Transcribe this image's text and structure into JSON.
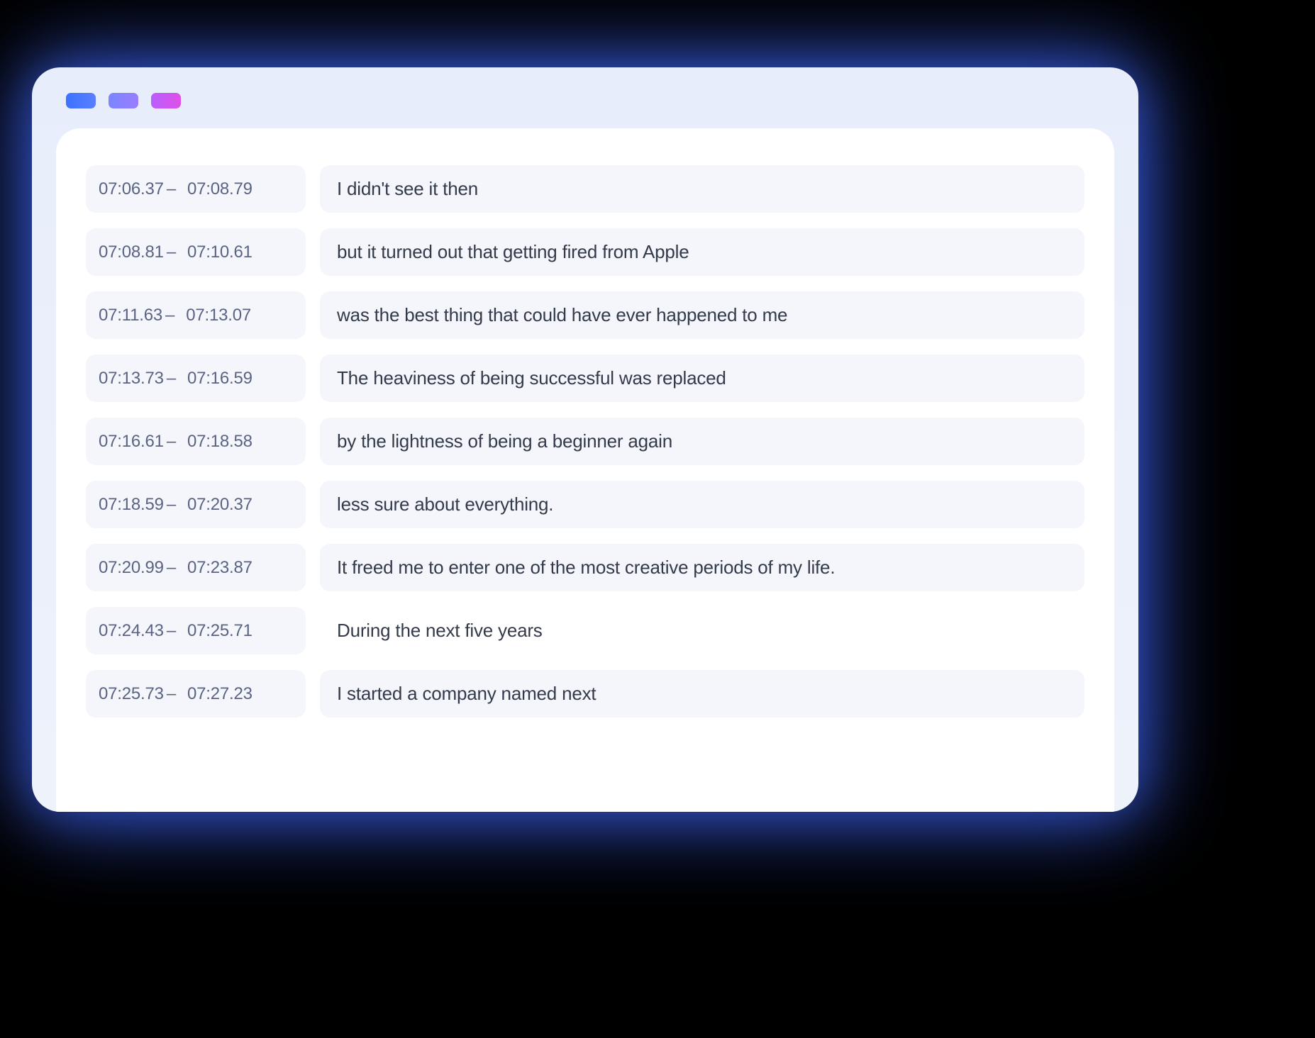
{
  "window": {
    "dots": [
      {
        "name": "window-control-1"
      },
      {
        "name": "window-control-2"
      },
      {
        "name": "window-control-3"
      }
    ]
  },
  "transcript": {
    "rows": [
      {
        "start": "07:06.37",
        "end": "07:08.79",
        "text": "I didn't see it then",
        "plain": false
      },
      {
        "start": "07:08.81",
        "end": "07:10.61",
        "text": "but it turned out that getting fired from Apple",
        "plain": false
      },
      {
        "start": "07:11.63",
        "end": "07:13.07",
        "text": "was the best thing that could have ever happened to me",
        "plain": false
      },
      {
        "start": "07:13.73",
        "end": "07:16.59",
        "text": "The heaviness of being successful was replaced",
        "plain": false
      },
      {
        "start": "07:16.61",
        "end": "07:18.58",
        "text": "by the lightness of being a beginner again",
        "plain": false
      },
      {
        "start": "07:18.59",
        "end": "07:20.37",
        "text": "less sure about everything.",
        "plain": false
      },
      {
        "start": "07:20.99",
        "end": "07:23.87",
        "text": "It freed me to enter one of the most creative periods of my life.",
        "plain": false
      },
      {
        "start": "07:24.43",
        "end": "07:25.71",
        "text": "During the next five years",
        "plain": true
      },
      {
        "start": "07:25.73",
        "end": "07:27.23",
        "text": "I started a company named next",
        "plain": false
      }
    ],
    "dash": "–"
  }
}
